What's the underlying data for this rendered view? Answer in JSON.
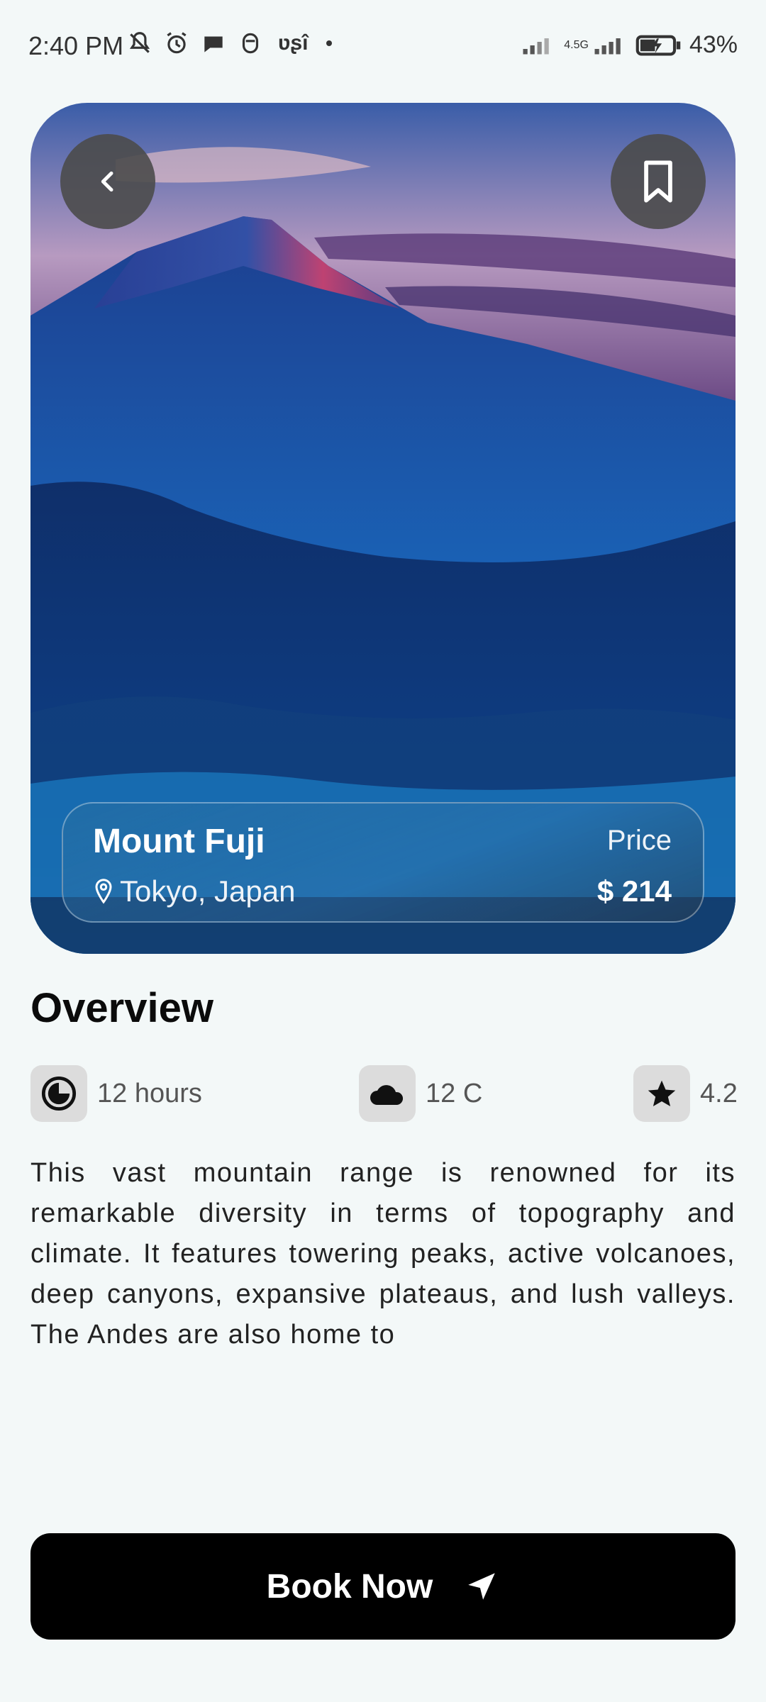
{
  "status_bar": {
    "time": "2:40 PM",
    "carrier_badge": "ʋʂî",
    "network": "4.5G",
    "battery": "43%"
  },
  "hero": {
    "title": "Mount Fuji",
    "location": "Tokyo, Japan",
    "price_label": "Price",
    "price_value": "$ 214",
    "back_icon": "chevron-left-icon",
    "bookmark_icon": "bookmark-icon"
  },
  "overview": {
    "title": "Overview",
    "stats": [
      {
        "icon": "clock-icon",
        "label": "12 hours"
      },
      {
        "icon": "cloud-icon",
        "label": "12 C"
      },
      {
        "icon": "star-icon",
        "label": "4.2"
      }
    ],
    "description": "This vast mountain range is renowned for its remarkable diversity in terms of topography and climate. It features towering peaks, active volcanoes, deep canyons, expansive plateaus, and lush valleys. The Andes are also home to"
  },
  "cta": {
    "label": "Book Now",
    "icon": "navigation-arrow-icon"
  },
  "colors": {
    "background": "#f3f8f8",
    "button": "#000000",
    "stat_icon_bg": "#dcdcdc"
  }
}
